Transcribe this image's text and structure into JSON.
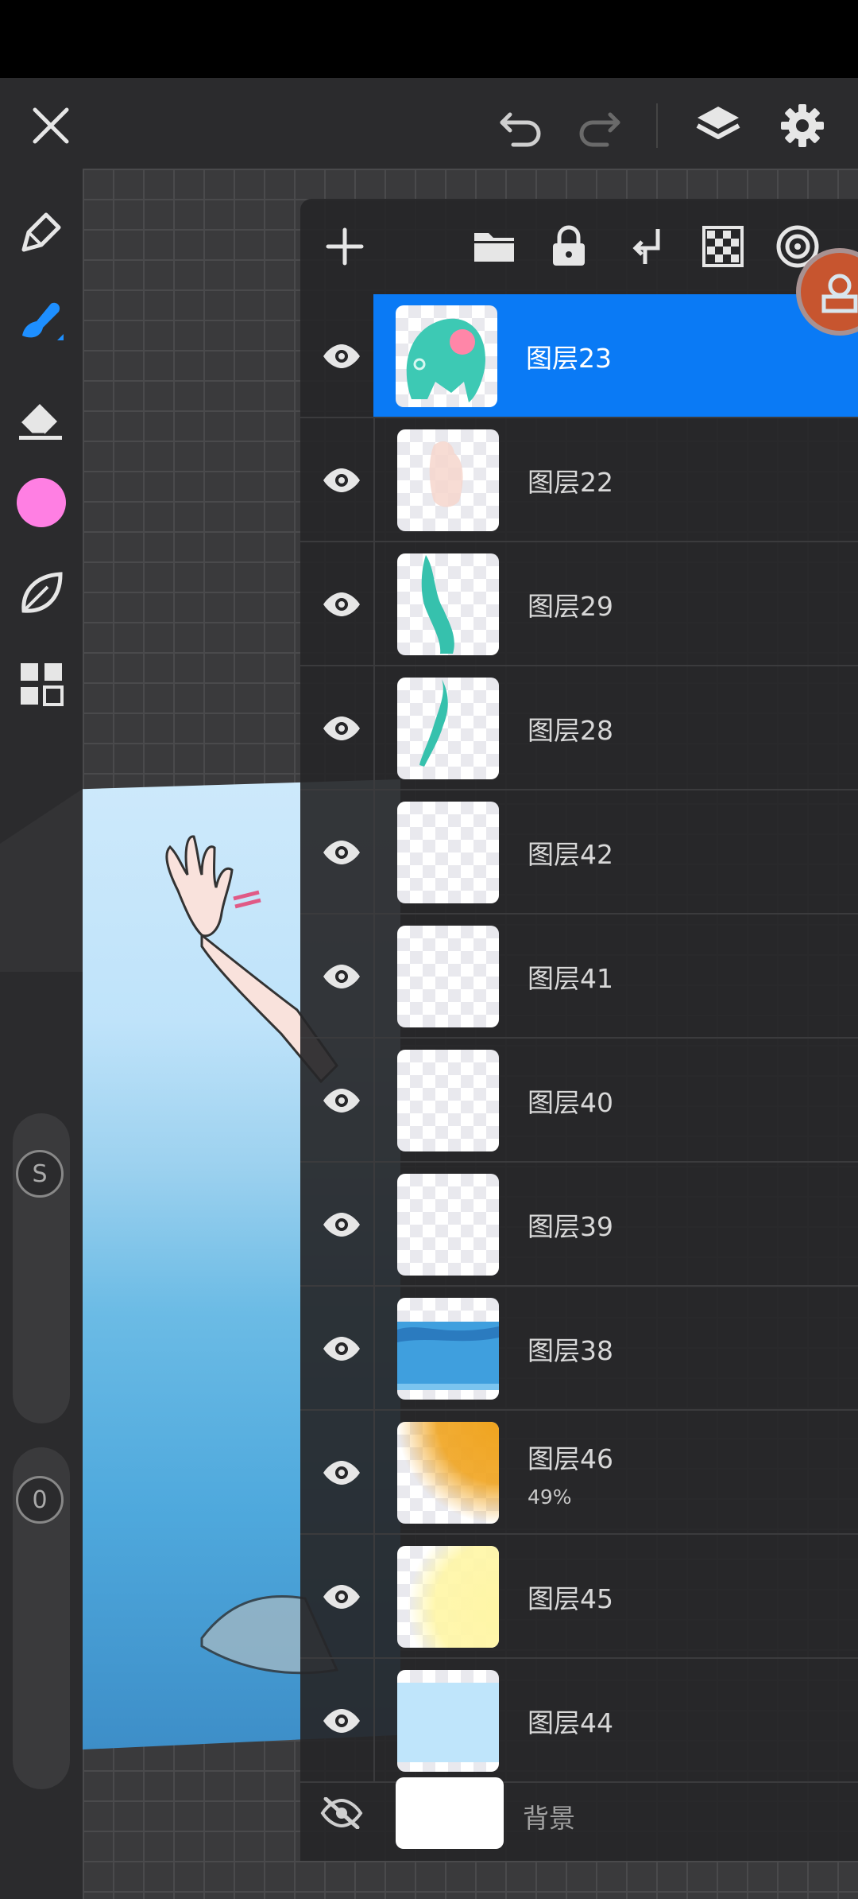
{
  "colors": {
    "accent": "#0a7af5",
    "brush_color": "#ff7fe3",
    "panel_bg": "#262628",
    "toolbar_bg": "#2b2b2d"
  },
  "top_bar": {
    "icons": [
      "close-icon",
      "undo-icon",
      "redo-icon",
      "layers-icon",
      "settings-icon"
    ]
  },
  "left_toolbar": {
    "tools": [
      "pencil-tool",
      "brush-tool",
      "eraser-tool",
      "color-picker",
      "smudge-tool",
      "grid-menu"
    ],
    "size_slider_label": "S",
    "opacity_slider_label": "0"
  },
  "layer_panel": {
    "toolbar_icons": [
      "add-layer-icon",
      "folder-icon",
      "lock-icon",
      "merge-down-icon",
      "checkerboard-icon",
      "target-icon"
    ],
    "layers": [
      {
        "name": "图层23",
        "selected": true,
        "visible": true,
        "thumb": "hair"
      },
      {
        "name": "图层22",
        "visible": true,
        "thumb": "skin"
      },
      {
        "name": "图层29",
        "visible": true,
        "thumb": "teal-strand"
      },
      {
        "name": "图层28",
        "visible": true,
        "thumb": "teal-strand-thin"
      },
      {
        "name": "图层42",
        "visible": true,
        "thumb": "empty"
      },
      {
        "name": "图层41",
        "visible": true,
        "thumb": "empty"
      },
      {
        "name": "图层40",
        "visible": true,
        "thumb": "empty"
      },
      {
        "name": "图层39",
        "visible": true,
        "thumb": "empty"
      },
      {
        "name": "图层38",
        "visible": true,
        "thumb": "blue-water"
      },
      {
        "name": "图层46",
        "opacity": "49%",
        "visible": true,
        "thumb": "orange-glow"
      },
      {
        "name": "图层45",
        "visible": true,
        "thumb": "yellow-glow"
      },
      {
        "name": "图层44",
        "visible": true,
        "thumb": "light-blue"
      }
    ],
    "background": {
      "name": "背景",
      "visible": false
    }
  }
}
